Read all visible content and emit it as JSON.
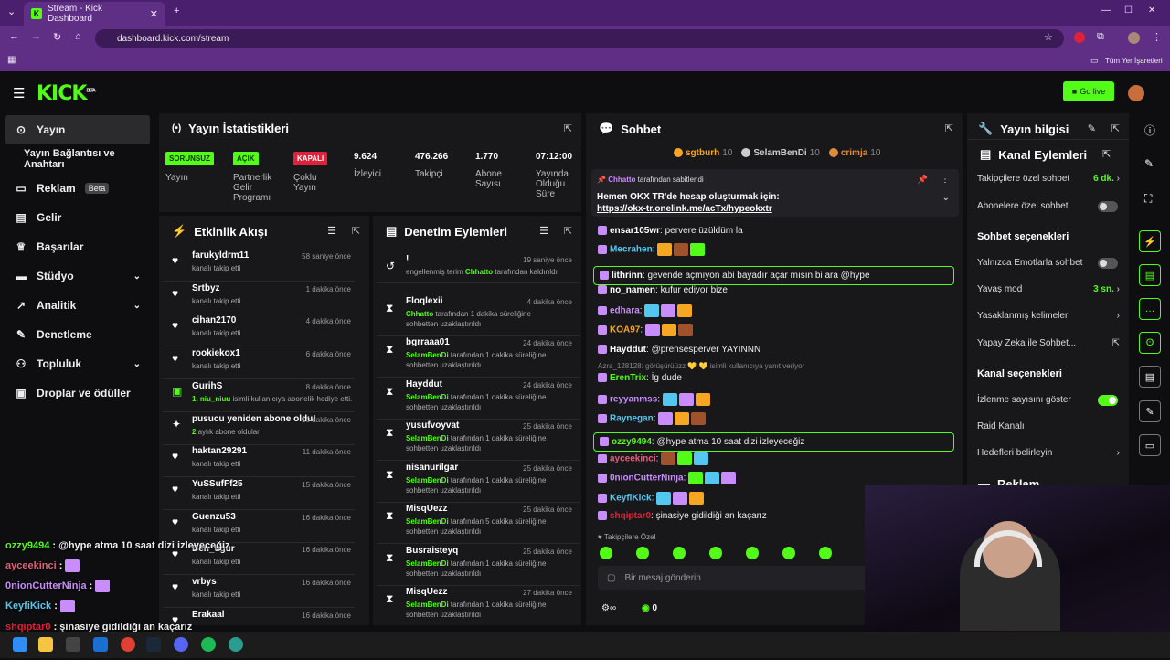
{
  "browser": {
    "tab_title": "Stream - Kick Dashboard",
    "url": "dashboard.kick.com/stream",
    "bookmarks_label": "Tüm Yer İşaretleri"
  },
  "header": {
    "logo": "KICK",
    "logo_badge": "BETA",
    "go_live": "Go live"
  },
  "sidebar": {
    "items": [
      {
        "label": "Yayın",
        "icon": "broadcast-icon"
      },
      {
        "label": "Yayın Bağlantısı ve Anahtarı",
        "icon": ""
      },
      {
        "label": "Reklam",
        "badge": "Beta",
        "icon": "tv-icon"
      },
      {
        "label": "Gelir",
        "icon": "chart-icon"
      },
      {
        "label": "Başarılar",
        "icon": "trophy-icon"
      },
      {
        "label": "Stüdyo",
        "icon": "studio-icon"
      },
      {
        "label": "Analitik",
        "icon": "analytics-icon"
      },
      {
        "label": "Denetleme",
        "icon": "wrench-icon"
      },
      {
        "label": "Topluluk",
        "icon": "community-icon"
      },
      {
        "label": "Droplar ve ödüller",
        "icon": "gift-icon"
      }
    ]
  },
  "stats": {
    "title": "Yayın İstatistikleri",
    "items": [
      {
        "pill": "SORUNSUZ",
        "label": "Yayın",
        "color": "#53fc18"
      },
      {
        "pill": "AÇIK",
        "label": "Partnerlik Gelir Programı",
        "color": "#53fc18"
      },
      {
        "pill": "KAPALI",
        "label": "Çoklu Yayın",
        "color": "#e0213b"
      },
      {
        "value": "9.624",
        "label": "İzleyici"
      },
      {
        "value": "476.266",
        "label": "Takipçi"
      },
      {
        "value": "1.770",
        "label": "Abone Sayısı"
      },
      {
        "value": "07:12:00",
        "label": "Yayında Olduğu Süre"
      }
    ]
  },
  "activity": {
    "title": "Etkinlik Akışı",
    "rows": [
      {
        "name": "farukyldrm11",
        "sub": "kanalı takip etti",
        "time": "58 saniye önce",
        "icon": "heart-icon"
      },
      {
        "name": "Srtbyz",
        "sub": "kanalı takip etti",
        "time": "1 dakika önce",
        "icon": "heart-icon"
      },
      {
        "name": "cihan2170",
        "sub": "kanalı takip etti",
        "time": "4 dakika önce",
        "icon": "heart-icon"
      },
      {
        "name": "rookiekox1",
        "sub": "kanalı takip etti",
        "time": "6 dakika önce",
        "icon": "heart-icon"
      },
      {
        "name": "GurihS",
        "sub_hl": "1, niu_niuu",
        "sub": " isimli kullanıcıya abonelik hediye etti.",
        "time": "8 dakika önce",
        "icon": "gift-icon"
      },
      {
        "name": "pusucu yeniden abone oldu!",
        "sub_hl": "2",
        "sub": " aylık abone oldular",
        "time": "10 dakika önce",
        "icon": "sparkle-icon"
      },
      {
        "name": "haktan29291",
        "sub": "kanalı takip etti",
        "time": "11 dakika önce",
        "icon": "heart-icon"
      },
      {
        "name": "YuSSufFf25",
        "sub": "kanalı takip etti",
        "time": "15 dakika önce",
        "icon": "heart-icon"
      },
      {
        "name": "Guenzu53",
        "sub": "kanalı takip etti",
        "time": "16 dakika önce",
        "icon": "heart-icon"
      },
      {
        "name": "Ben_ugur",
        "sub": "kanalı takip etti",
        "time": "16 dakika önce",
        "icon": "heart-icon"
      },
      {
        "name": "vrbys",
        "sub": "kanalı takip etti",
        "time": "16 dakika önce",
        "icon": "heart-icon"
      },
      {
        "name": "Erakaal",
        "sub": "",
        "time": "16 dakika önce",
        "icon": "heart-icon"
      }
    ]
  },
  "moderation": {
    "title": "Denetim Eylemleri",
    "rows": [
      {
        "name": "!",
        "time": "19 saniye önce",
        "pre": "engellenmiş terim ",
        "hl": "Chhatto",
        "post": " tarafından kaldırıldı",
        "icon": "undo-icon"
      },
      {
        "name": "Floqlexii",
        "time": "4 dakika önce",
        "hl": "Chhatto",
        "post": " tarafından 1 dakika süreliğine sohbetten uzaklaştırıldı",
        "icon": "hourglass-icon"
      },
      {
        "name": "bgrraaa01",
        "time": "24 dakika önce",
        "hl": "SelamBenDi",
        "post": " tarafından 1 dakika süreliğine sohbetten uzaklaştırıldı",
        "icon": "hourglass-icon"
      },
      {
        "name": "Hayddut",
        "time": "24 dakika önce",
        "hl": "SelamBenDi",
        "post": " tarafından 1 dakika süreliğine sohbetten uzaklaştırıldı",
        "icon": "hourglass-icon"
      },
      {
        "name": "yusufvoyvat",
        "time": "25 dakika önce",
        "hl": "SelamBenDi",
        "post": " tarafından 1 dakika süreliğine sohbetten uzaklaştırıldı",
        "icon": "hourglass-icon"
      },
      {
        "name": "nisanurilgar",
        "time": "25 dakika önce",
        "hl": "SelamBenDi",
        "post": " tarafından 1 dakika süreliğine sohbetten uzaklaştırıldı",
        "icon": "hourglass-icon"
      },
      {
        "name": "MisqUezz",
        "time": "25 dakika önce",
        "hl": "SelamBenDi",
        "post": " tarafından 5 dakika süreliğine sohbetten uzaklaştırıldı",
        "icon": "hourglass-icon"
      },
      {
        "name": "Busraisteyq",
        "time": "25 dakika önce",
        "hl": "SelamBenDi",
        "post": " tarafından 1 dakika süreliğine sohbetten uzaklaştırıldı",
        "icon": "hourglass-icon"
      },
      {
        "name": "MisqUezz",
        "time": "27 dakika önce",
        "hl": "SelamBenDi",
        "post": " tarafından 1 dakika süreliğine sohbetten uzaklaştırıldı",
        "icon": "hourglass-icon"
      }
    ]
  },
  "chat": {
    "title": "Sohbet",
    "top": [
      {
        "name": "sgtburh",
        "count": "10",
        "color": "#f5a623"
      },
      {
        "name": "SelamBenDi",
        "count": "10",
        "color": "#cccccc"
      },
      {
        "name": "crimja",
        "count": "10",
        "color": "#e08a3a"
      }
    ],
    "pinned": {
      "by": "Chhatto",
      "by_suffix": " tarafından sabitlendi",
      "text": "Hemen OKX TR'de hesap oluşturmak için: ",
      "link": "https://okx-tr.onelink.me/acTx/hypeokxtr"
    },
    "messages": [
      {
        "user": "ensar105wr",
        "text": "pervere üzüldüm la",
        "color": "#ffffff"
      },
      {
        "user": "Mecrahen",
        "text": "",
        "color": "#53c7f0"
      },
      {
        "user": "lithrinn",
        "text": "gevende açmıyon abi bayadır açar mısın bi ara @hype",
        "color": "#ffffff",
        "highlight": true
      },
      {
        "user": "no_namen",
        "text": "kufur ediyor bize",
        "color": "#ffffff"
      },
      {
        "user": "edhara",
        "text": "",
        "color": "#c88dfa"
      },
      {
        "user": "KOA97",
        "text": "",
        "color": "#f5a623"
      },
      {
        "user": "Hayddut",
        "text": "@prensesperver YAYINNN",
        "color": "#ffffff"
      },
      {
        "reply": "Azra_128128: görüşürüüzz",
        "reply2": "isimli kullanıcıya yanıt veriyor"
      },
      {
        "user": "ErenTrix",
        "text": "İg dude",
        "color": "#53fc18"
      },
      {
        "user": "reyyanmss",
        "text": "",
        "color": "#c88dfa"
      },
      {
        "user": "Raynegan",
        "text": "",
        "color": "#53c7f0"
      },
      {
        "user": "ozzy9494",
        "text": "@hype atma 10 saat dizi izleyeceğiz",
        "color": "#53fc18",
        "highlight": true
      },
      {
        "user": "ayceekinci",
        "text": "",
        "color": "#e0607a"
      },
      {
        "user": "0nionCutterNinja",
        "text": "",
        "color": "#c88dfa"
      },
      {
        "user": "KeyfiKick",
        "text": "",
        "color": "#53c7f0"
      },
      {
        "user": "shqiptar0",
        "text": "şinasiye gidildiği an kaçarız",
        "color": "#e0213b"
      }
    ],
    "followers_only": "Takipçilere Özel",
    "input_placeholder": "Bir mesaj gönderin",
    "footer_count": "0"
  },
  "right": {
    "title": "Yayın bilgisi",
    "sub_title": "Kanal Eylemleri",
    "followers_chat": "Takipçilere özel sohbet",
    "followers_chat_val": "6 dk.",
    "subs_chat": "Abonelere özel sohbet",
    "chat_options": "Sohbet seçenekleri",
    "emotes_only": "Yalnızca Emotlarla sohbet",
    "slow_mode": "Yavaş mod",
    "slow_mode_val": "3 sn.",
    "banned_words": "Yasaklanmış kelimeler",
    "ai": "Yapay Zeka ile Sohbet...",
    "channel_options": "Kanal seçenekleri",
    "show_viewers": "İzlenme sayısını göster",
    "raid": "Raid Kanalı",
    "goals": "Hedefleri belirleyin",
    "ads": "Reklam"
  },
  "overlay": [
    {
      "user": "ozzy9494",
      "text": "@hype atma 10 saat dizi izleyeceğiz",
      "color": "#53fc18"
    },
    {
      "user": "ayceekinci",
      "text": "",
      "color": "#e0607a"
    },
    {
      "user": "0nionCutterNinja",
      "text": "",
      "color": "#c88dfa"
    },
    {
      "user": "KeyfiKick",
      "text": "",
      "color": "#53c7f0"
    },
    {
      "user": "shqiptar0",
      "text": "şinasiye gidildiği an kaçarız",
      "color": "#e0213b"
    }
  ]
}
